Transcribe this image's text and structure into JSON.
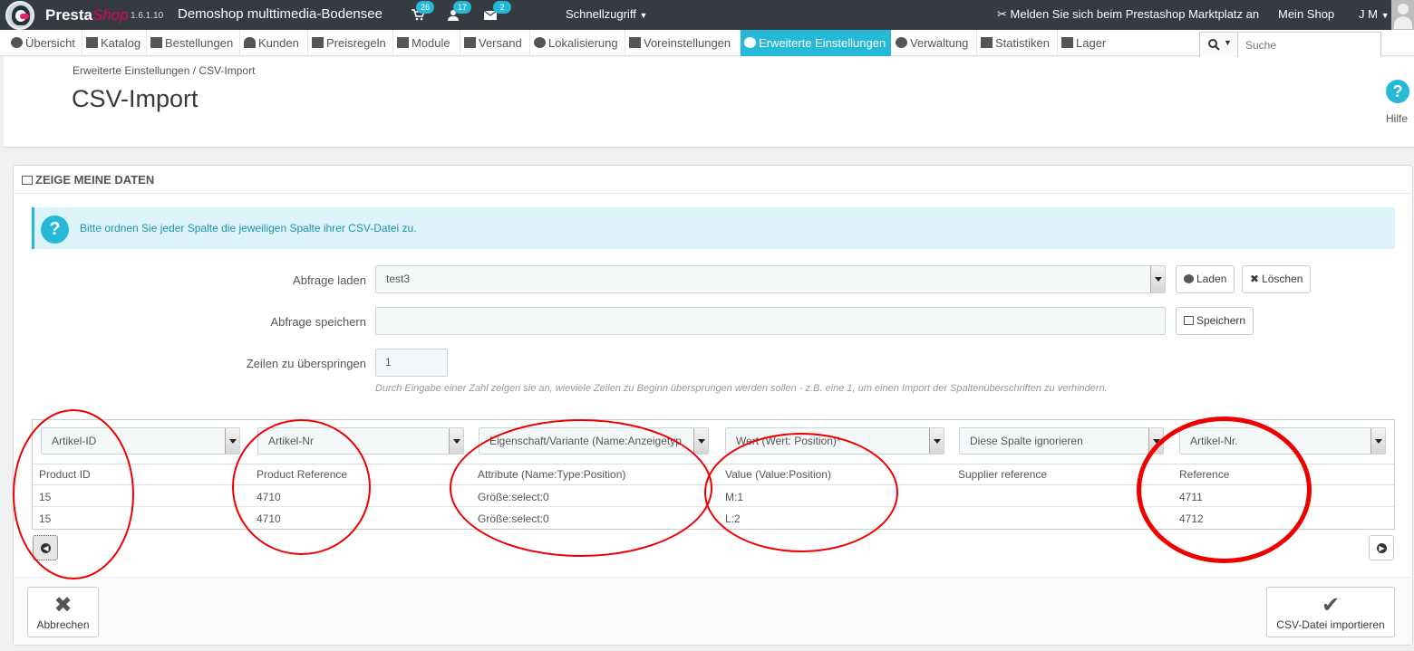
{
  "topbar": {
    "brand_main": "Presta",
    "brand_accent": "Shop",
    "version": "1.6.1.10",
    "shop_name": "Demoshop multtimedia-Bodensee",
    "badges": {
      "orders": "26",
      "customers": "17",
      "messages": "2"
    },
    "quick_access": "Schnellzugriff",
    "marketplace": "Melden Sie sich beim Prestashop Marktplatz an",
    "my_shop": "Mein Shop",
    "user": "J M"
  },
  "nav": {
    "items": [
      {
        "label": "Übersicht"
      },
      {
        "label": "Katalog"
      },
      {
        "label": "Bestellungen"
      },
      {
        "label": "Kunden"
      },
      {
        "label": "Preisregeln"
      },
      {
        "label": "Module"
      },
      {
        "label": "Versand"
      },
      {
        "label": "Lokalisierung"
      },
      {
        "label": "Voreinstellungen"
      },
      {
        "label": "Erweiterte Einstellungen"
      },
      {
        "label": "Verwaltung"
      },
      {
        "label": "Statistiken"
      },
      {
        "label": "Lager"
      }
    ],
    "search_placeholder": "Suche"
  },
  "header": {
    "breadcrumb": "Erweiterte Einstellungen   /   CSV-Import",
    "title": "CSV-Import",
    "help": "Hilfe"
  },
  "panel": {
    "heading": "ZEIGE MEINE DATEN",
    "alert": "Bitte ordnen Sie jeder Spalte die jeweiligen Spalte ihrer CSV-Datei zu.",
    "load_query_label": "Abfrage laden",
    "load_query_value": "test3",
    "load_button": "Laden",
    "delete_button": "Löschen",
    "save_query_label": "Abfrage speichern",
    "save_button": "Speichern",
    "skip_rows_label": "Zeilen zu überspringen",
    "skip_rows_value": "1",
    "hint": "Durch Eingabe einer Zahl zeigen sie an, wieviele Zeilen zu Beginn übersprungen werden sollen - z.B. eine 1, um einen Import der Spaltenüberschriften zu verhindern."
  },
  "table": {
    "column_selects": [
      "Artikel-ID",
      "Artikel-Nr",
      "Eigenschaft/Variante (Name:Anzeigetyp",
      "Wert (Wert: Position)*",
      "Diese Spalte ignorieren",
      "Artikel-Nr."
    ],
    "headers": [
      "Product ID",
      "Product Reference",
      "Attribute (Name:Type:Position)",
      "Value (Value:Position)",
      "Supplier reference",
      "Reference"
    ],
    "rows": [
      [
        "15",
        "4710",
        "Größe:select:0",
        "M:1",
        "",
        "4711"
      ],
      [
        "15",
        "4710",
        "Größe:select:0",
        "L:2",
        "",
        "4712"
      ]
    ]
  },
  "footer": {
    "cancel": "Abbrechen",
    "import": "CSV-Datei importieren"
  },
  "colors": {
    "accent": "#25b9d7",
    "topbar": "#363a41",
    "brand_pink": "#df0067",
    "annotation_red": "#e00000"
  }
}
